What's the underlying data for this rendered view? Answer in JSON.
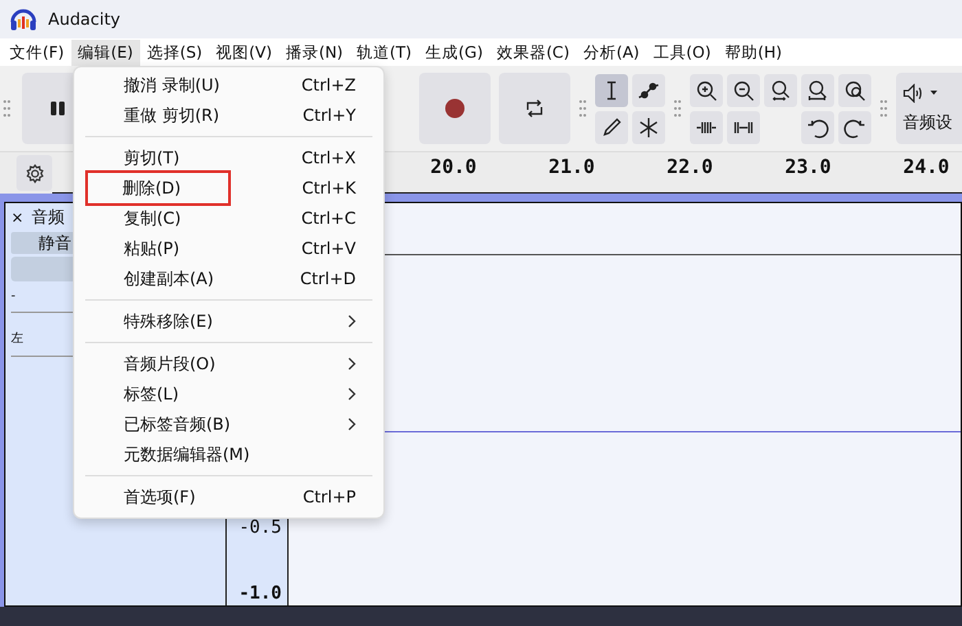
{
  "window": {
    "title": "Audacity"
  },
  "menubar": [
    {
      "label": "文件(F)",
      "selected": false
    },
    {
      "label": "编辑(E)",
      "selected": true
    },
    {
      "label": "选择(S)",
      "selected": false
    },
    {
      "label": "视图(V)",
      "selected": false
    },
    {
      "label": "播录(N)",
      "selected": false
    },
    {
      "label": "轨道(T)",
      "selected": false
    },
    {
      "label": "生成(G)",
      "selected": false
    },
    {
      "label": "效果器(C)",
      "selected": false
    },
    {
      "label": "分析(A)",
      "selected": false
    },
    {
      "label": "工具(O)",
      "selected": false
    },
    {
      "label": "帮助(H)",
      "selected": false
    }
  ],
  "tools": [
    {
      "kind": "select",
      "selected": true
    },
    {
      "kind": "envelope",
      "selected": false
    },
    {
      "kind": "draw",
      "selected": false
    },
    {
      "kind": "multi",
      "selected": false
    }
  ],
  "audio_setup": {
    "label": "音频设"
  },
  "ruler": {
    "labels": [
      "20.0",
      "21.0",
      "22.0",
      "23.0",
      "24.0"
    ]
  },
  "track": {
    "close": "×",
    "name": "音频",
    "mute": "静音",
    "gain_mark": "-",
    "pan_mark": "左",
    "scale": [
      "-0.5",
      "-1.0"
    ]
  },
  "edit_menu": [
    {
      "kind": "item",
      "label": "撤消 录制(U)",
      "shortcut": "Ctrl+Z",
      "submenu": false,
      "marked": false
    },
    {
      "kind": "item",
      "label": "重做 剪切(R)",
      "shortcut": "Ctrl+Y",
      "submenu": false,
      "marked": false
    },
    {
      "kind": "separator"
    },
    {
      "kind": "item",
      "label": "剪切(T)",
      "shortcut": "Ctrl+X",
      "submenu": false,
      "marked": false
    },
    {
      "kind": "item",
      "label": "删除(D)",
      "shortcut": "Ctrl+K",
      "submenu": false,
      "marked": true
    },
    {
      "kind": "item",
      "label": "复制(C)",
      "shortcut": "Ctrl+C",
      "submenu": false,
      "marked": false
    },
    {
      "kind": "item",
      "label": "粘贴(P)",
      "shortcut": "Ctrl+V",
      "submenu": false,
      "marked": false
    },
    {
      "kind": "item",
      "label": "创建副本(A)",
      "shortcut": "Ctrl+D",
      "submenu": false,
      "marked": false
    },
    {
      "kind": "separator"
    },
    {
      "kind": "item",
      "label": "特殊移除(E)",
      "submenu": true,
      "marked": false
    },
    {
      "kind": "separator"
    },
    {
      "kind": "item",
      "label": "音频片段(O)",
      "submenu": true,
      "marked": false
    },
    {
      "kind": "item",
      "label": "标签(L)",
      "submenu": true,
      "marked": false
    },
    {
      "kind": "item",
      "label": "已标签音频(B)",
      "submenu": true,
      "marked": false
    },
    {
      "kind": "item",
      "label": "元数据编辑器(M)",
      "submenu": false,
      "marked": false
    },
    {
      "kind": "separator"
    },
    {
      "kind": "item",
      "label": "首选项(F)",
      "shortcut": "Ctrl+P",
      "submenu": false,
      "marked": false
    }
  ]
}
